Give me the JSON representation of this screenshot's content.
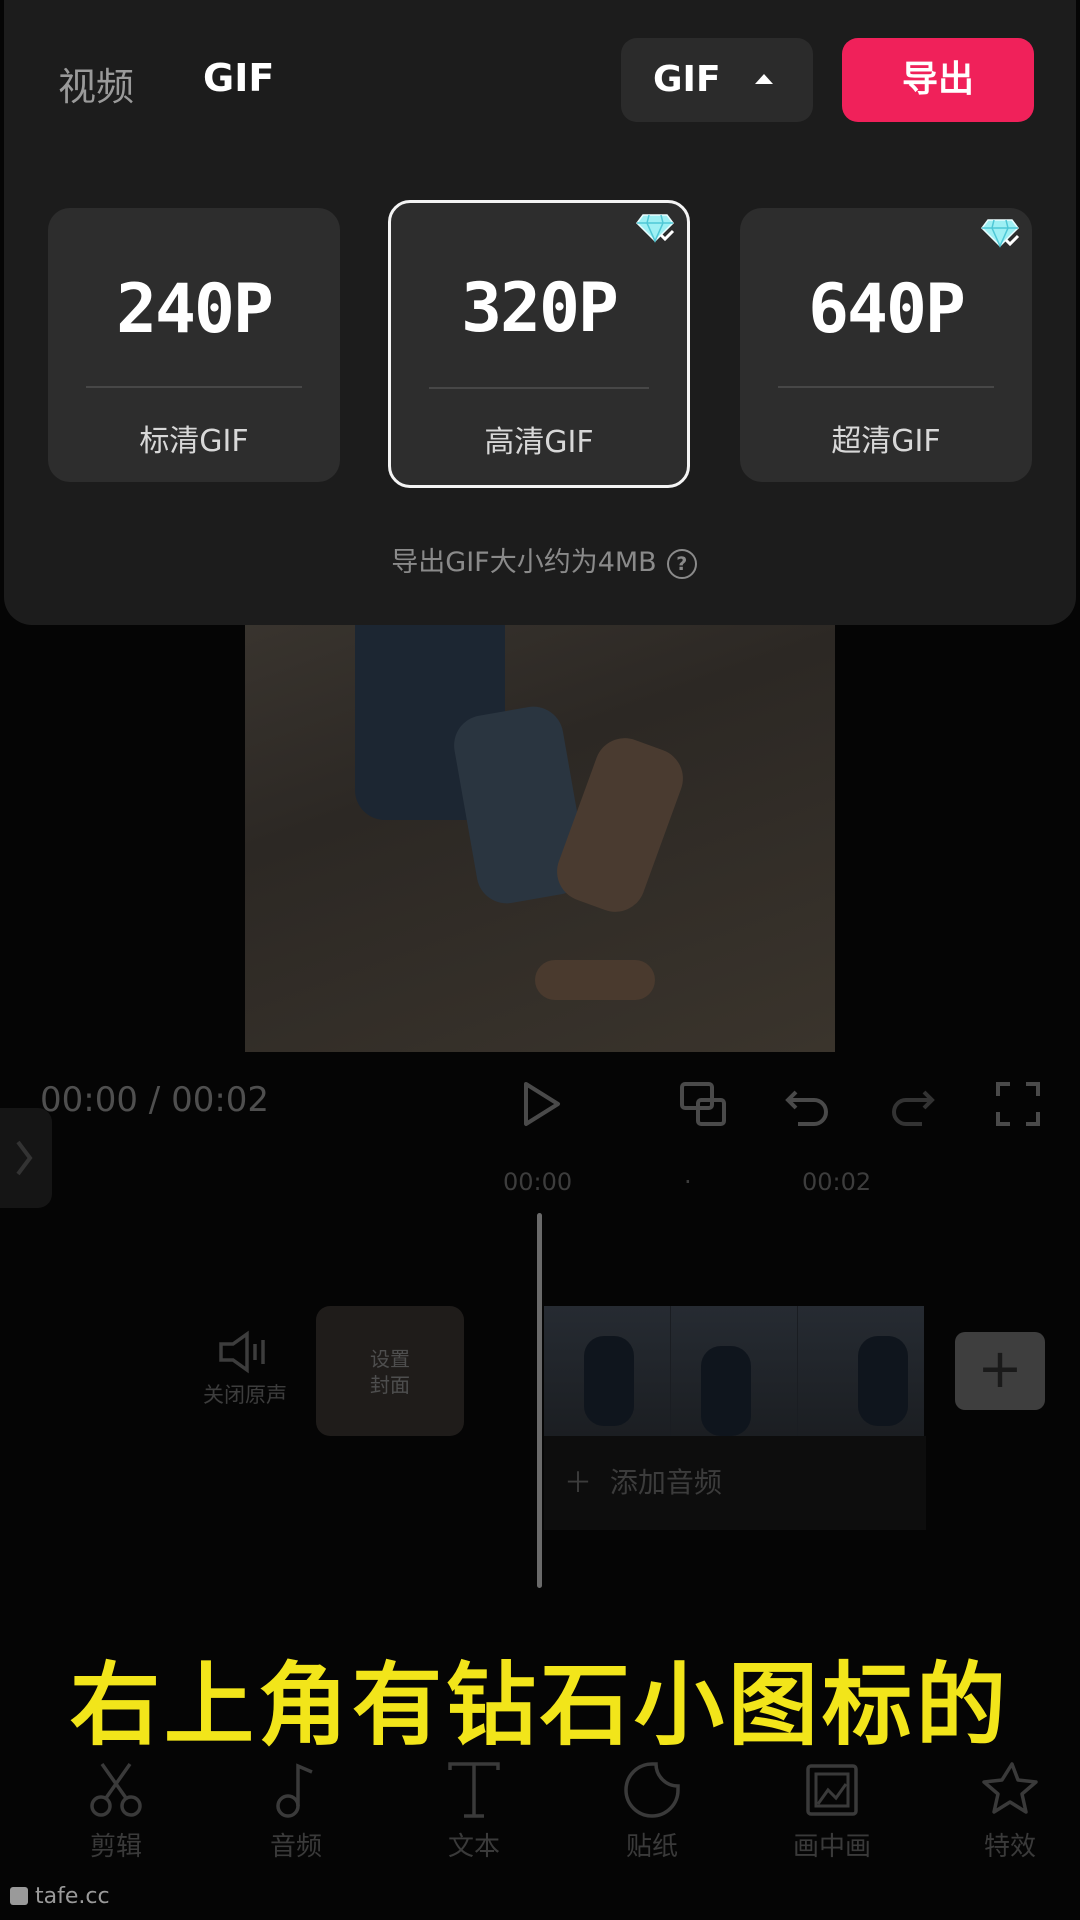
{
  "panel": {
    "tabs": {
      "video": "视频",
      "gif": "GIF"
    },
    "format_button": {
      "label": "GIF"
    },
    "export_button": {
      "label": "导出"
    },
    "options": [
      {
        "resolution": "240P",
        "label": "标清GIF",
        "premium": false,
        "selected": false
      },
      {
        "resolution": "320P",
        "label": "高清GIF",
        "premium": true,
        "selected": true
      },
      {
        "resolution": "640P",
        "label": "超清GIF",
        "premium": true,
        "selected": false
      }
    ],
    "size_note": "导出GIF大小约为4MB",
    "help_glyph": "?"
  },
  "player": {
    "current_time": "00:00",
    "separator": " / ",
    "total_time": "00:02"
  },
  "timeline": {
    "ruler": [
      "00:00",
      "·",
      "00:02"
    ],
    "mute_label": "关闭原声",
    "cover_label_1": "设置",
    "cover_label_2": "封面",
    "add_audio": "添加音频",
    "add_clip": "+"
  },
  "caption": "右上角有钻石小图标的",
  "toolbar": [
    {
      "label": "剪辑",
      "icon": "scissors-icon"
    },
    {
      "label": "音频",
      "icon": "music-note-icon"
    },
    {
      "label": "文本",
      "icon": "text-icon"
    },
    {
      "label": "贴纸",
      "icon": "sticker-icon"
    },
    {
      "label": "画中画",
      "icon": "picture-in-picture-icon"
    },
    {
      "label": "特效",
      "icon": "effects-star-icon"
    }
  ],
  "watermark": "tafe.cc",
  "colors": {
    "accent": "#f0215a",
    "caption": "#f2e51a",
    "panel": "#1c1c1c",
    "card": "#2d2d2d"
  }
}
